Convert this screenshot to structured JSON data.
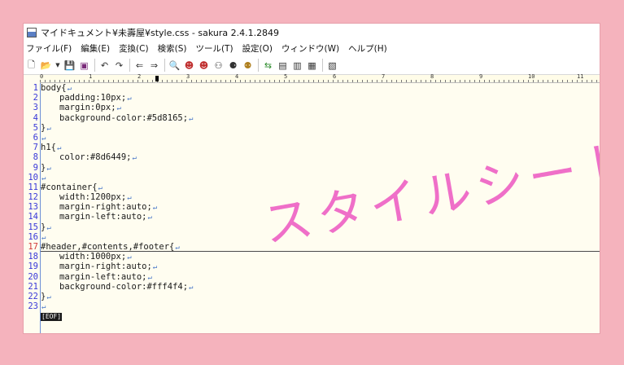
{
  "window": {
    "title": "マイドキュメント¥未壽屋¥style.css - sakura 2.4.1.2849"
  },
  "menu": [
    "ファイル(F)",
    "編集(E)",
    "変換(C)",
    "検索(S)",
    "ツール(T)",
    "設定(O)",
    "ウィンドウ(W)",
    "ヘルプ(H)"
  ],
  "toolbar_icons": [
    "new-file-icon",
    "open-folder-icon",
    "dropdown-arrow-icon",
    "save-icon",
    "save-all-icon",
    "undo-icon",
    "redo-icon",
    "jump-back-icon",
    "jump-forward-icon",
    "search-icon",
    "search-prev-icon",
    "search-next-icon",
    "search-files-icon",
    "replace-icon",
    "grep-icon",
    "tag-jump-icon",
    "outline-icon",
    "compare-icon",
    "print-icon",
    "settings-icon"
  ],
  "ruler": {
    "numbers": [
      "0",
      "1",
      "2",
      "3",
      "4",
      "5",
      "6",
      "7",
      "8",
      "9",
      "10",
      "11"
    ]
  },
  "editor": {
    "current_line": 17,
    "lines": [
      {
        "n": "1",
        "text": "body{",
        "indent": false
      },
      {
        "n": "2",
        "text": "padding:10px;",
        "indent": true
      },
      {
        "n": "3",
        "text": "margin:0px;",
        "indent": true
      },
      {
        "n": "4",
        "text": "background-color:#5d8165;",
        "indent": true
      },
      {
        "n": "5",
        "text": "}",
        "indent": false
      },
      {
        "n": "6",
        "text": "",
        "indent": false
      },
      {
        "n": "7",
        "text": "h1{",
        "indent": false
      },
      {
        "n": "8",
        "text": "color:#8d6449;",
        "indent": true
      },
      {
        "n": "9",
        "text": "}",
        "indent": false
      },
      {
        "n": "10",
        "text": "",
        "indent": false
      },
      {
        "n": "11",
        "text": "#container{",
        "indent": false
      },
      {
        "n": "12",
        "text": "width:1200px;",
        "indent": true
      },
      {
        "n": "13",
        "text": "margin-right:auto;",
        "indent": true
      },
      {
        "n": "14",
        "text": "margin-left:auto;",
        "indent": true
      },
      {
        "n": "15",
        "text": "}",
        "indent": false
      },
      {
        "n": "16",
        "text": "",
        "indent": false
      },
      {
        "n": "17",
        "text": "#header,#contents,#footer{",
        "indent": false
      },
      {
        "n": "18",
        "text": "width:1000px;",
        "indent": true
      },
      {
        "n": "19",
        "text": "margin-right:auto;",
        "indent": true
      },
      {
        "n": "20",
        "text": "margin-left:auto;",
        "indent": true
      },
      {
        "n": "21",
        "text": "background-color:#fff4f4;",
        "indent": true
      },
      {
        "n": "22",
        "text": "}",
        "indent": false
      },
      {
        "n": "23",
        "text": "",
        "indent": false
      }
    ],
    "newline_mark": "↵",
    "eof_mark": "[EOF]"
  },
  "overlay": {
    "text": "スタイルシート",
    "color": "#ef6fc8"
  }
}
